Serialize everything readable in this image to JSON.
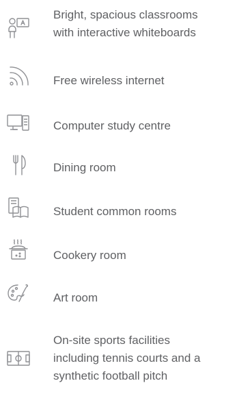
{
  "colors": {
    "text": "#5f6063",
    "icon_stroke": "#8f9094",
    "background": "#ffffff"
  },
  "features": [
    {
      "icon": "classroom-teacher-board-icon",
      "label": "Bright, spacious classrooms\nwith interactive whiteboards"
    },
    {
      "icon": "wifi-icon",
      "label": "Free wireless internet"
    },
    {
      "icon": "computer-icon",
      "label": "Computer study centre"
    },
    {
      "icon": "fork-knife-icon",
      "label": "Dining room"
    },
    {
      "icon": "common-room-book-icon",
      "label": "Student common rooms"
    },
    {
      "icon": "cooking-pot-icon",
      "label": "Cookery room"
    },
    {
      "icon": "paint-palette-icon",
      "label": "Art room"
    },
    {
      "icon": "sports-pitch-icon",
      "label": "On-site sports facilities\nincluding tennis courts and a\nsynthetic football pitch"
    }
  ]
}
